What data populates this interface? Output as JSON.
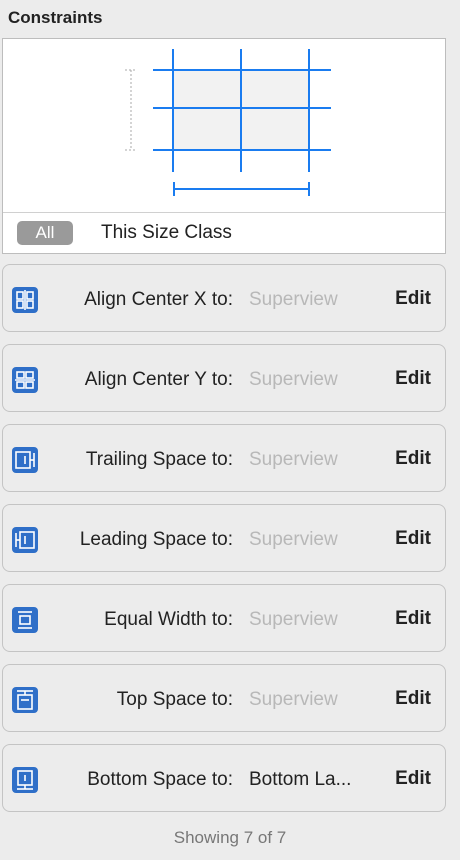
{
  "panel": {
    "title": "Constraints"
  },
  "scope": {
    "all_label": "All",
    "size_class_label": "This Size Class"
  },
  "colors": {
    "accent": "#1a7cf0",
    "icon_blue": "#2f6fc8",
    "placeholder": "#b8b8b8"
  },
  "constraints": [
    {
      "label": "Align Center X to:",
      "target": "Superview",
      "target_is_placeholder": true,
      "edit": "Edit",
      "icon": "align-center-x-icon"
    },
    {
      "label": "Align Center Y to:",
      "target": "Superview",
      "target_is_placeholder": true,
      "edit": "Edit",
      "icon": "align-center-y-icon"
    },
    {
      "label": "Trailing Space to:",
      "target": "Superview",
      "target_is_placeholder": true,
      "edit": "Edit",
      "icon": "trailing-space-icon"
    },
    {
      "label": "Leading Space to:",
      "target": "Superview",
      "target_is_placeholder": true,
      "edit": "Edit",
      "icon": "leading-space-icon"
    },
    {
      "label": "Equal Width to:",
      "target": "Superview",
      "target_is_placeholder": true,
      "edit": "Edit",
      "icon": "equal-width-icon"
    },
    {
      "label": "Top Space to:",
      "target": "Superview",
      "target_is_placeholder": true,
      "edit": "Edit",
      "icon": "top-space-icon"
    },
    {
      "label": "Bottom Space to:",
      "target": "Bottom La...",
      "target_is_placeholder": false,
      "edit": "Edit",
      "icon": "bottom-space-icon"
    }
  ],
  "footer": {
    "text": "Showing 7 of 7"
  }
}
